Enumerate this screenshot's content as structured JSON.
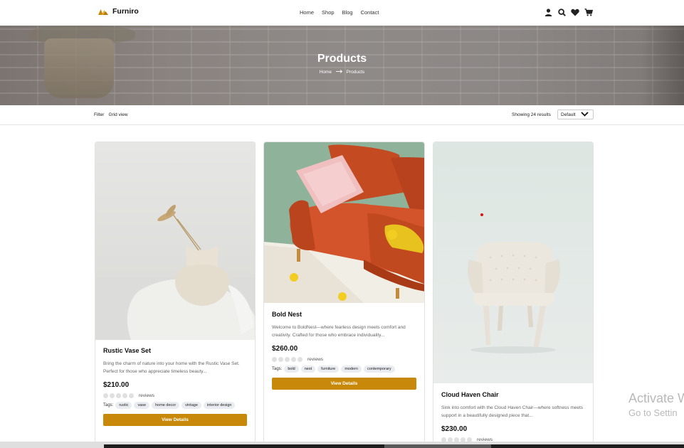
{
  "brand": {
    "name": "Furniro",
    "accent": "#c8890a"
  },
  "nav": {
    "items": [
      "Home",
      "Shop",
      "Blog",
      "Contact"
    ]
  },
  "header_icons": [
    "user-icon",
    "search-icon",
    "heart-icon",
    "cart-icon"
  ],
  "hero": {
    "title": "Products",
    "breadcrumb_home": "Home",
    "breadcrumb_current": "Products"
  },
  "filterbar": {
    "filter_label": "Filter",
    "view_label": "Grid view",
    "showing": "Showing 24 results",
    "sort_selected": "Default"
  },
  "products": [
    {
      "title": "Rustic Vase Set",
      "description": "Bring the charm of nature into your home with the Rustic Vase Set. Perfect for those who appreciate timeless beauty...",
      "price": "$210.00",
      "reviews_label": "reviews",
      "tags_label": "Tags:",
      "tags": [
        "rustic",
        "vase",
        "home decor",
        "vintage",
        "interior design"
      ],
      "button": "View Details"
    },
    {
      "title": "Bold Nest",
      "description": "Welcome to BoldNest—where fearless design meets comfort and creativity. Crafted for those who embrace individuality...",
      "price": "$260.00",
      "reviews_label": "reviews",
      "tags_label": "Tags:",
      "tags": [
        "bold",
        "nest",
        "furniture",
        "modern",
        "contemporary"
      ],
      "button": "View Details"
    },
    {
      "title": "Cloud Haven Chair",
      "description": "Sink into comfort with the Cloud Haven Chair—where softness meets support in a beautifully designed piece that...",
      "price": "$230.00",
      "reviews_label": "reviews"
    }
  ],
  "watermark": {
    "line1": "Activate W",
    "line2": "Go to Settin"
  }
}
